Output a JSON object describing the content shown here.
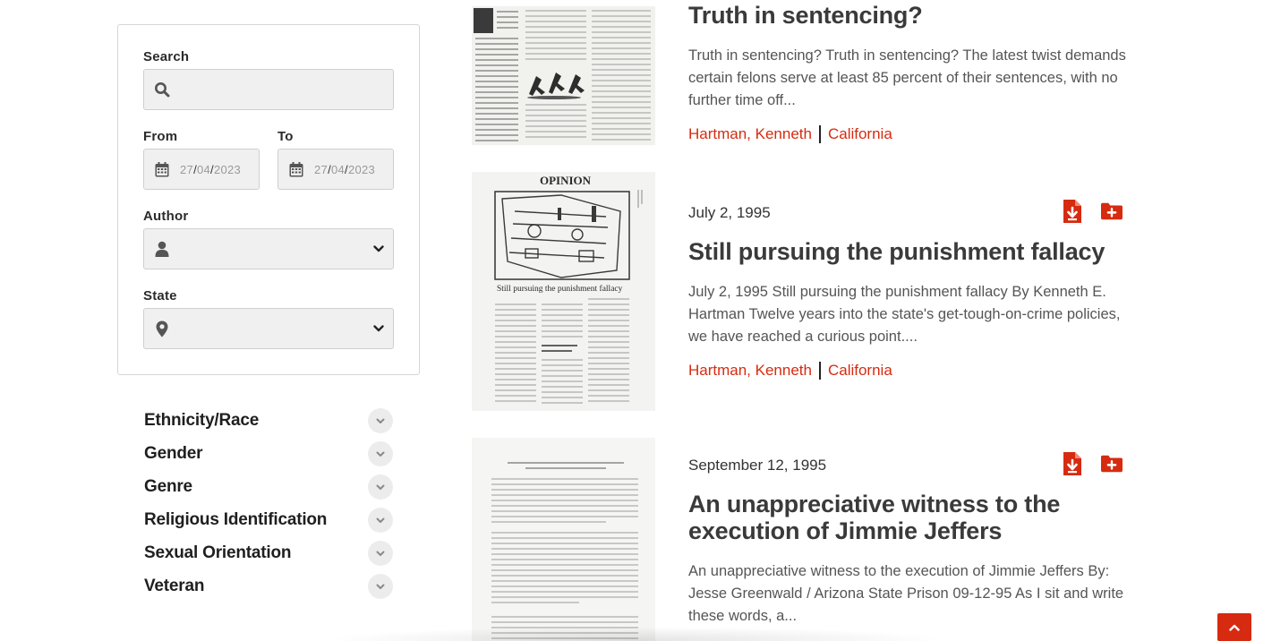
{
  "filters": {
    "search_label": "Search",
    "search_placeholder": "",
    "from_label": "From",
    "to_label": "To",
    "from_date": {
      "day": "27",
      "month": "04",
      "year": "2023"
    },
    "to_date": {
      "day": "27",
      "month": "04",
      "year": "2023"
    },
    "author_label": "Author",
    "author_value": "",
    "state_label": "State",
    "state_value": ""
  },
  "facets": [
    {
      "label": "Ethnicity/Race"
    },
    {
      "label": "Gender"
    },
    {
      "label": "Genre"
    },
    {
      "label": "Religious Identification"
    },
    {
      "label": "Sexual Orientation"
    },
    {
      "label": "Veteran"
    }
  ],
  "results": [
    {
      "date": "",
      "title": "Truth in sentencing?",
      "snippet": "Truth in sentencing? Truth in sentencing? The latest twist demands certain felons serve at least 85 percent of their sentences, with no further time off...",
      "author": "Hartman, Kenneth",
      "state": "California"
    },
    {
      "date": "July 2, 1995",
      "title": "Still pursuing the punishment fallacy",
      "snippet": "July 2, 1995 Still pursuing the punishment fallacy By Kenneth E. Hartman Twelve years into the state's get-tough-on-crime policies, we have reached a curious point....",
      "author": "Hartman, Kenneth",
      "state": "California",
      "thumb_heading": "OPINION",
      "thumb_caption": "Still pursuing the punishment fallacy"
    },
    {
      "date": "September 12, 1995",
      "title": "An unappreciative witness to the execution of Jimmie Jeffers",
      "snippet": "An unappreciative witness to the execution of Jimmie Jeffers By: Jesse Greenwald / Arizona State Prison 09-12-95 As I sit and write these words, a...",
      "author": "",
      "state": ""
    }
  ],
  "icons": {
    "search": "search-icon",
    "calendar": "calendar-icon",
    "user": "user-icon",
    "location": "map-marker-icon",
    "chevron": "chevron-down-icon",
    "download": "download-file-icon",
    "add_folder": "folder-plus-icon",
    "back_to_top": "chevron-up-icon"
  },
  "colors": {
    "accent": "#d62b10",
    "title": "#3a3a3a",
    "text": "#555555",
    "input_bg": "#f0f0f0"
  }
}
